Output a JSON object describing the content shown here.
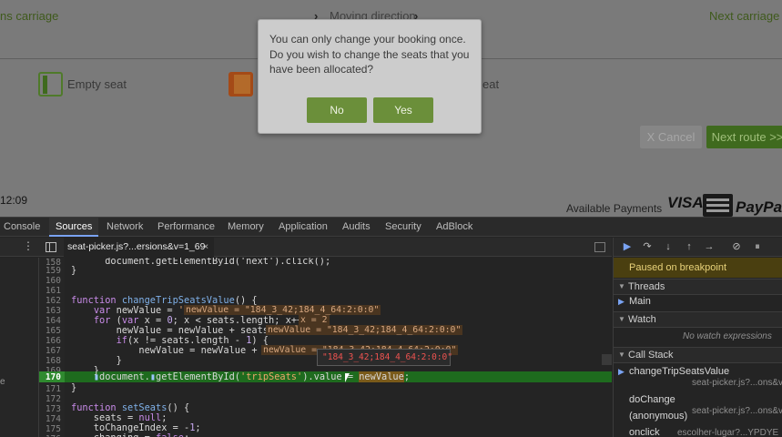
{
  "website": {
    "prev_carriage": "ns carriage",
    "moving_direction": "Moving direction",
    "next_carriage": "Next carriage",
    "legend_empty": "Empty seat",
    "legend_partial": "eat",
    "cancel_label": "X Cancel",
    "next_route_label": "Next route >>",
    "clock": "12:09",
    "available_payments": "Available Payments",
    "payment_logos": [
      "VISA",
      "PayPa"
    ]
  },
  "modal": {
    "message": "You can only change your booking once. Do you wish to change the seats that you have been allocated?",
    "no_label": "No",
    "yes_label": "Yes"
  },
  "devtools": {
    "tabs": [
      "Console",
      "Sources",
      "Network",
      "Performance",
      "Memory",
      "Application",
      "Audits",
      "Security",
      "AdBlock"
    ],
    "active_tab": "Sources",
    "file_tab": "seat-picker.js?...ersions&v=1_69",
    "file_close": "×",
    "paused_message": "Paused on breakpoint",
    "sections": {
      "threads": "Threads",
      "main_thread": "Main",
      "watch": "Watch",
      "no_watch": "No watch expressions",
      "call_stack": "Call Stack"
    },
    "call_stack": [
      {
        "fn": "changeTripSeatsValue",
        "file": "seat-picker.js?...ons&v"
      },
      {
        "fn": "doChange",
        "file": "seat-picker.js?...ons&v"
      },
      {
        "fn": "(anonymous)",
        "file": ""
      },
      {
        "fn": "onclick",
        "file": "escolher-lugar?...YPDYE"
      }
    ],
    "left_fragment": "e",
    "current_line": "170",
    "tooltip": "\"184_3_42;184_4_64:2:0:0\"",
    "line_numbers": [
      "158",
      "159",
      "160",
      "161",
      "162",
      "163",
      "164",
      "165",
      "166",
      "167",
      "168",
      "169",
      "170",
      "171",
      "172",
      "173",
      "174",
      "175",
      "176"
    ],
    "inline_values": {
      "newValue_163": "newValue = \"184_3_42;184_4_64:2:0:0\"",
      "x_164": "x = 2",
      "newValue_165": "newValue = \"184_3_42;184_4_64:2:0:0\"",
      "newValue_167": "newValue = \"184_3_42;184_4_64:2:0:0\""
    }
  }
}
